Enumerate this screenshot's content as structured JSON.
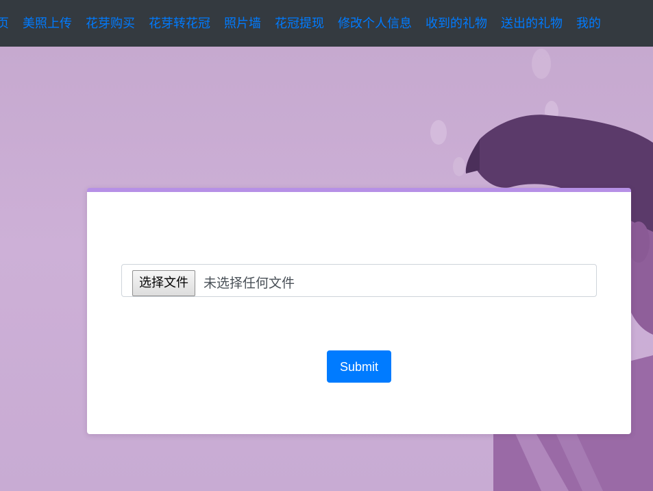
{
  "nav": {
    "items": [
      {
        "label": "页"
      },
      {
        "label": "美照上传"
      },
      {
        "label": "花芽购买"
      },
      {
        "label": "花芽转花冠"
      },
      {
        "label": "照片墙"
      },
      {
        "label": "花冠提现"
      },
      {
        "label": "修改个人信息"
      },
      {
        "label": "收到的礼物"
      },
      {
        "label": "送出的礼物"
      },
      {
        "label": "我的"
      }
    ]
  },
  "form": {
    "file_button_label": "选择文件",
    "file_status": "未选择任何文件",
    "submit_label": "Submit"
  },
  "colors": {
    "navbar_bg": "#343a40",
    "link": "#007bff",
    "card_accent": "#b690e6",
    "background": "#c9acd4"
  }
}
